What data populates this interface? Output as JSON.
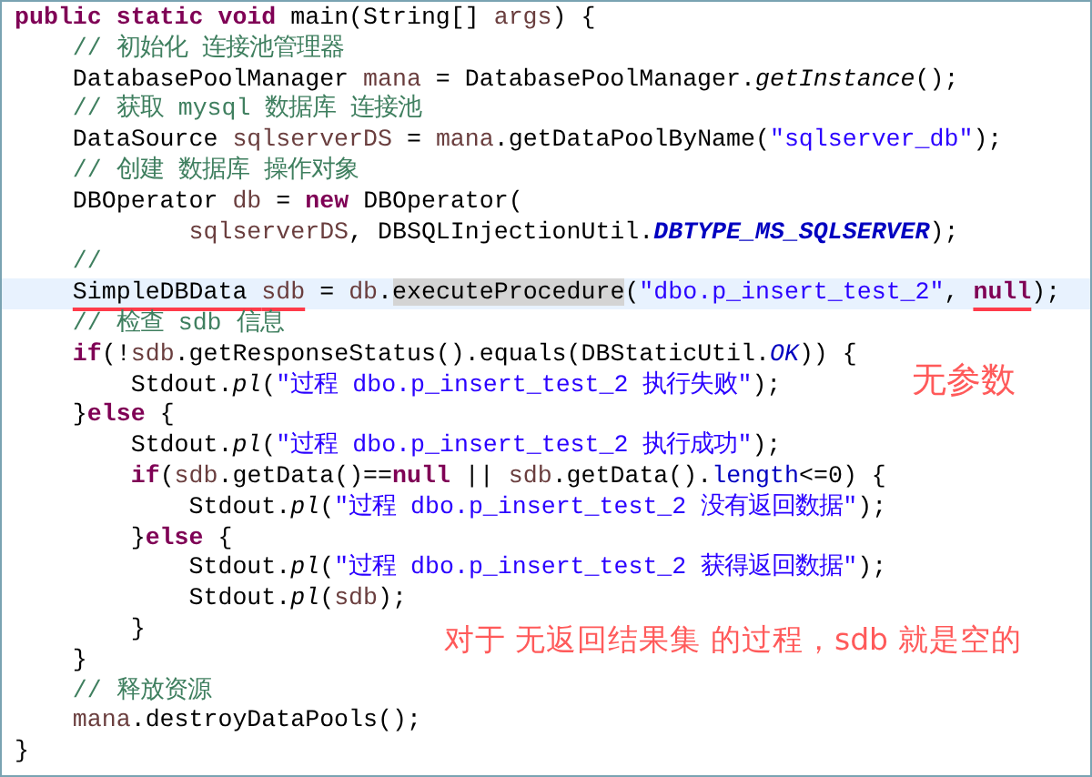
{
  "code_lines": [
    {
      "highlighted": false,
      "tokens": [
        {
          "text": "public static void",
          "kind": "keyword"
        },
        {
          "text": " main(String[] ",
          "kind": "plain"
        },
        {
          "text": "args",
          "kind": "variable"
        },
        {
          "text": ") {",
          "kind": "plain"
        }
      ]
    },
    {
      "highlighted": false,
      "tokens": [
        {
          "text": "    // 初始化 连接池管理器",
          "kind": "comment"
        }
      ]
    },
    {
      "highlighted": false,
      "tokens": [
        {
          "text": "    DatabasePoolManager ",
          "kind": "plain"
        },
        {
          "text": "mana",
          "kind": "variable"
        },
        {
          "text": " = DatabasePoolManager.",
          "kind": "plain"
        },
        {
          "text": "getInstance",
          "kind": "static_method"
        },
        {
          "text": "();",
          "kind": "plain"
        }
      ]
    },
    {
      "highlighted": false,
      "tokens": [
        {
          "text": "    // 获取 mysql 数据库 连接池",
          "kind": "comment"
        }
      ]
    },
    {
      "highlighted": false,
      "tokens": [
        {
          "text": "    DataSource ",
          "kind": "plain"
        },
        {
          "text": "sqlserverDS",
          "kind": "variable"
        },
        {
          "text": " = ",
          "kind": "plain"
        },
        {
          "text": "mana",
          "kind": "variable"
        },
        {
          "text": ".getDataPoolByName(",
          "kind": "plain"
        },
        {
          "text": "\"sqlserver_db\"",
          "kind": "string"
        },
        {
          "text": ");",
          "kind": "plain"
        }
      ]
    },
    {
      "highlighted": false,
      "tokens": [
        {
          "text": "    // 创建 数据库 操作对象",
          "kind": "comment"
        }
      ]
    },
    {
      "highlighted": false,
      "tokens": [
        {
          "text": "    DBOperator ",
          "kind": "plain"
        },
        {
          "text": "db",
          "kind": "variable"
        },
        {
          "text": " = ",
          "kind": "plain"
        },
        {
          "text": "new",
          "kind": "keyword"
        },
        {
          "text": " DBOperator(",
          "kind": "plain"
        }
      ]
    },
    {
      "highlighted": false,
      "tokens": [
        {
          "text": "            sqlserverDS",
          "kind": "variable"
        },
        {
          "text": ", DBSQLInjectionUtil.",
          "kind": "plain"
        },
        {
          "text": "DBTYPE_MS_SQLSERVER",
          "kind": "constant"
        },
        {
          "text": ");",
          "kind": "plain"
        }
      ]
    },
    {
      "highlighted": false,
      "tokens": [
        {
          "text": "    //",
          "kind": "comment"
        }
      ]
    },
    {
      "highlighted": true,
      "tokens": [
        {
          "text": "    SimpleDBData ",
          "kind": "plain",
          "underlined": true
        },
        {
          "text": "sdb",
          "kind": "variable",
          "underlined": true
        },
        {
          "text": " = ",
          "kind": "plain"
        },
        {
          "text": "db",
          "kind": "variable"
        },
        {
          "text": ".",
          "kind": "plain"
        },
        {
          "text": "executeProcedure",
          "kind": "occurrence"
        },
        {
          "text": "(",
          "kind": "plain"
        },
        {
          "text": "\"dbo.p_insert_test_2\"",
          "kind": "string"
        },
        {
          "text": ", ",
          "kind": "plain"
        },
        {
          "text": "null",
          "kind": "keyword",
          "underlined": true
        },
        {
          "text": ");",
          "kind": "plain"
        }
      ]
    },
    {
      "highlighted": false,
      "tokens": [
        {
          "text": "    // 检查 sdb 信息",
          "kind": "comment"
        }
      ]
    },
    {
      "highlighted": false,
      "tokens": [
        {
          "text": "    if",
          "kind": "keyword"
        },
        {
          "text": "(!",
          "kind": "plain"
        },
        {
          "text": "sdb",
          "kind": "variable"
        },
        {
          "text": ".getResponseStatus().equals(DBStaticUtil.",
          "kind": "plain"
        },
        {
          "text": "OK",
          "kind": "static_field"
        },
        {
          "text": ")) {",
          "kind": "plain"
        }
      ]
    },
    {
      "highlighted": false,
      "tokens": [
        {
          "text": "        Stdout.",
          "kind": "plain"
        },
        {
          "text": "pl",
          "kind": "static_method"
        },
        {
          "text": "(",
          "kind": "plain"
        },
        {
          "text": "\"过程 dbo.p_insert_test_2 执行失败\"",
          "kind": "string"
        },
        {
          "text": ");",
          "kind": "plain"
        }
      ]
    },
    {
      "highlighted": false,
      "tokens": [
        {
          "text": "    }",
          "kind": "plain"
        },
        {
          "text": "else",
          "kind": "keyword"
        },
        {
          "text": " {",
          "kind": "plain"
        }
      ]
    },
    {
      "highlighted": false,
      "tokens": [
        {
          "text": "        Stdout.",
          "kind": "plain"
        },
        {
          "text": "pl",
          "kind": "static_method"
        },
        {
          "text": "(",
          "kind": "plain"
        },
        {
          "text": "\"过程 dbo.p_insert_test_2 执行成功\"",
          "kind": "string"
        },
        {
          "text": ");",
          "kind": "plain"
        }
      ]
    },
    {
      "highlighted": false,
      "tokens": [
        {
          "text": "        if",
          "kind": "keyword"
        },
        {
          "text": "(",
          "kind": "plain"
        },
        {
          "text": "sdb",
          "kind": "variable"
        },
        {
          "text": ".getData()==",
          "kind": "plain"
        },
        {
          "text": "null",
          "kind": "keyword"
        },
        {
          "text": " || ",
          "kind": "plain"
        },
        {
          "text": "sdb",
          "kind": "variable"
        },
        {
          "text": ".getData().",
          "kind": "plain"
        },
        {
          "text": "length",
          "kind": "field"
        },
        {
          "text": "<=0) {",
          "kind": "plain"
        }
      ]
    },
    {
      "highlighted": false,
      "tokens": [
        {
          "text": "            Stdout.",
          "kind": "plain"
        },
        {
          "text": "pl",
          "kind": "static_method"
        },
        {
          "text": "(",
          "kind": "plain"
        },
        {
          "text": "\"过程 dbo.p_insert_test_2 没有返回数据\"",
          "kind": "string"
        },
        {
          "text": ");",
          "kind": "plain"
        }
      ]
    },
    {
      "highlighted": false,
      "tokens": [
        {
          "text": "        }",
          "kind": "plain"
        },
        {
          "text": "else",
          "kind": "keyword"
        },
        {
          "text": " {",
          "kind": "plain"
        }
      ]
    },
    {
      "highlighted": false,
      "tokens": [
        {
          "text": "            Stdout.",
          "kind": "plain"
        },
        {
          "text": "pl",
          "kind": "static_method"
        },
        {
          "text": "(",
          "kind": "plain"
        },
        {
          "text": "\"过程 dbo.p_insert_test_2 获得返回数据\"",
          "kind": "string"
        },
        {
          "text": ");",
          "kind": "plain"
        }
      ]
    },
    {
      "highlighted": false,
      "tokens": [
        {
          "text": "            Stdout.",
          "kind": "plain"
        },
        {
          "text": "pl",
          "kind": "static_method"
        },
        {
          "text": "(",
          "kind": "plain"
        },
        {
          "text": "sdb",
          "kind": "variable"
        },
        {
          "text": ");",
          "kind": "plain"
        }
      ]
    },
    {
      "highlighted": false,
      "tokens": [
        {
          "text": "        }",
          "kind": "plain"
        }
      ]
    },
    {
      "highlighted": false,
      "tokens": [
        {
          "text": "    }",
          "kind": "plain"
        }
      ]
    },
    {
      "highlighted": false,
      "tokens": [
        {
          "text": "    // 释放资源",
          "kind": "comment"
        }
      ]
    },
    {
      "highlighted": false,
      "tokens": [
        {
          "text": "    mana",
          "kind": "variable"
        },
        {
          "text": ".destroyDataPools();",
          "kind": "plain"
        }
      ]
    },
    {
      "highlighted": false,
      "tokens": [
        {
          "text": "}",
          "kind": "plain"
        }
      ]
    }
  ],
  "annotations": [
    "无参数",
    "对于 无返回结果集 的过程，sdb 就是空的"
  ]
}
